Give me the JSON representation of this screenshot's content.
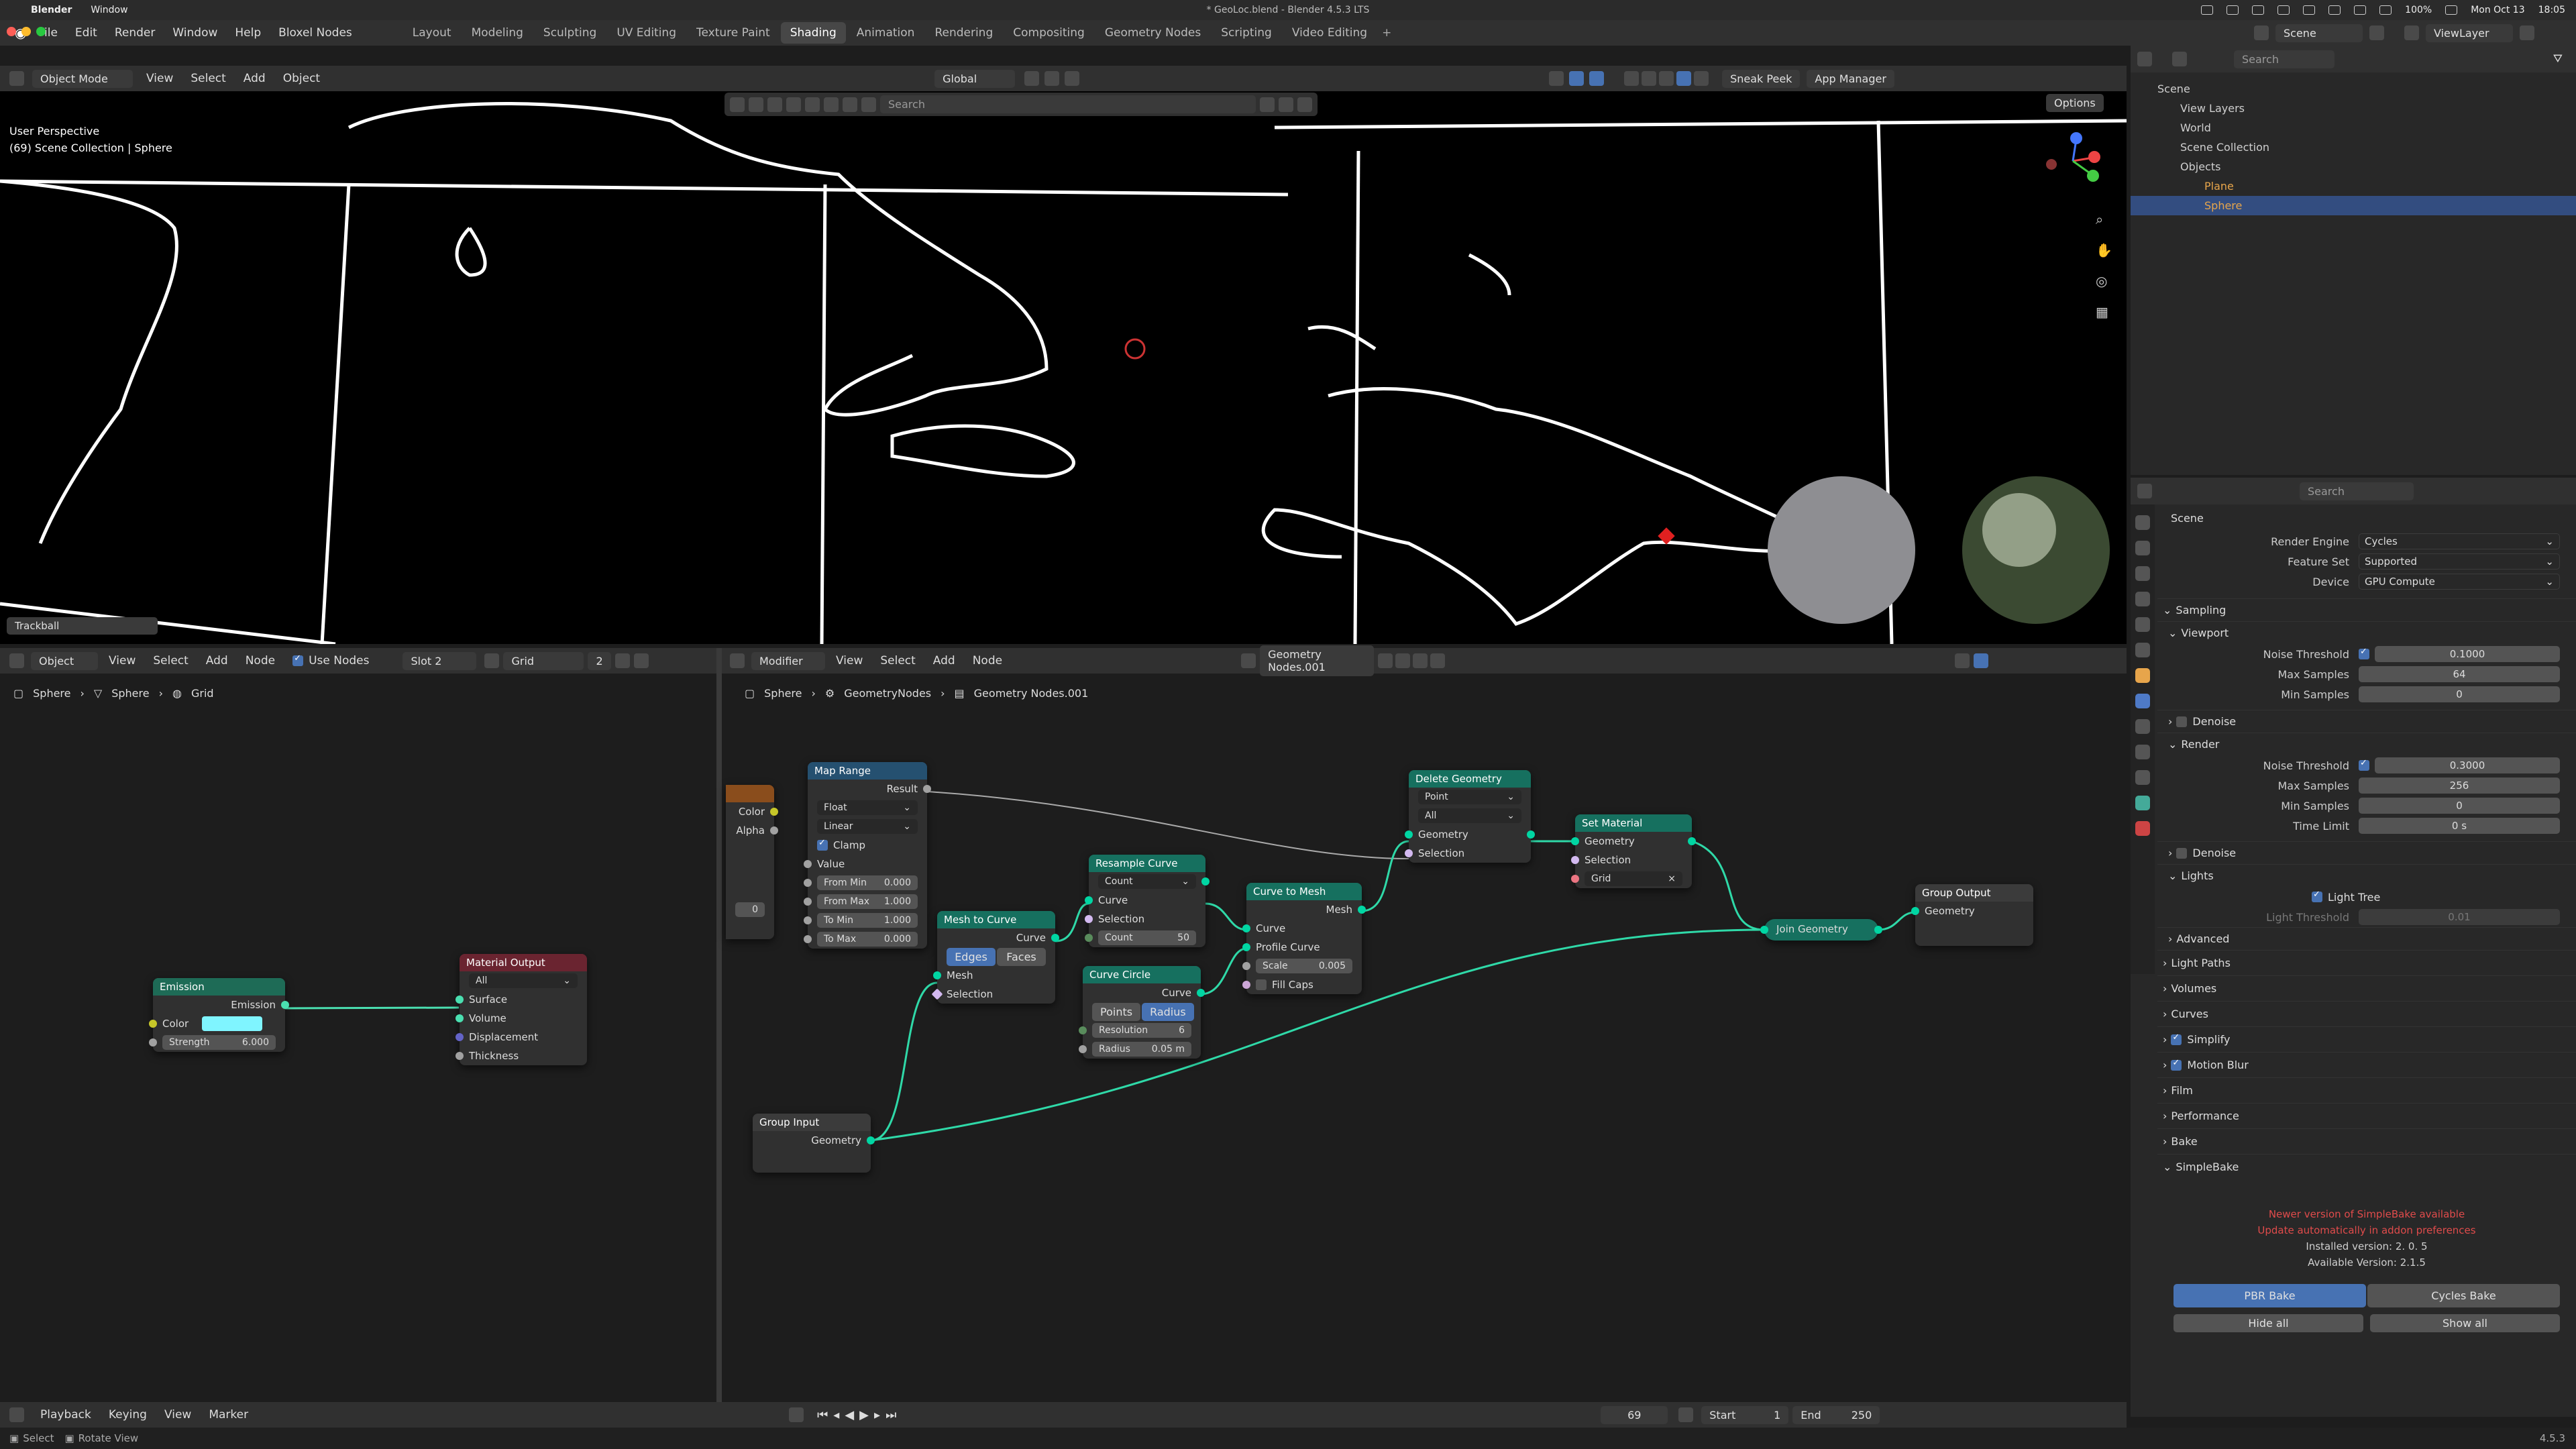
{
  "macbar": {
    "app": "Blender",
    "window": "Window",
    "title": "* GeoLoc.blend - Blender 4.5.3 LTS",
    "date": "Mon Oct 13",
    "time": "18:05",
    "battery": "100%"
  },
  "menu": [
    "File",
    "Edit",
    "Render",
    "Window",
    "Help",
    "Bloxel Nodes"
  ],
  "workspaces": [
    "Layout",
    "Modeling",
    "Sculpting",
    "UV Editing",
    "Texture Paint",
    "Shading",
    "Animation",
    "Rendering",
    "Compositing",
    "Geometry Nodes",
    "Scripting",
    "Video Editing"
  ],
  "active_workspace": "Shading",
  "scene": {
    "name": "Scene",
    "viewlayer": "ViewLayer"
  },
  "viewport": {
    "mode": "Object Mode",
    "menus": [
      "View",
      "Select",
      "Add",
      "Object"
    ],
    "orientation": "Global",
    "search_placeholder": "Search",
    "perspective": "User Perspective",
    "collection": "(69) Scene Collection | Sphere",
    "trackball": "Trackball",
    "sneak_peek": "Sneak Peek",
    "app_manager": "App Manager",
    "options": "Options"
  },
  "shader_editor": {
    "type": "Object",
    "menus": [
      "View",
      "Select",
      "Add",
      "Node"
    ],
    "use_nodes": "Use Nodes",
    "slot": "Slot 2",
    "material": "Grid",
    "users": "2",
    "breadcrumb": [
      "Sphere",
      "Sphere",
      "Grid"
    ],
    "emission": {
      "title": "Emission",
      "out": "Emission",
      "color": "Color",
      "strength_label": "Strength",
      "strength": "6.000",
      "color_hex": "#7ff5ff"
    },
    "material_output": {
      "title": "Material Output",
      "target": "All",
      "inputs": [
        "Surface",
        "Volume",
        "Displacement",
        "Thickness"
      ]
    }
  },
  "geo_editor": {
    "type": "Modifier",
    "menus": [
      "View",
      "Select",
      "Add",
      "Node"
    ],
    "tree": "Geometry Nodes.001",
    "breadcrumb": [
      "Sphere",
      "GeometryNodes",
      "Geometry Nodes.001"
    ],
    "partial": {
      "color": "Color",
      "alpha": "Alpha",
      "value": "0"
    },
    "map_range": {
      "title": "Map Range",
      "result": "Result",
      "type": "Float",
      "interp": "Linear",
      "clamp": "Clamp",
      "value": "Value",
      "rows": [
        [
          "From Min",
          "0.000"
        ],
        [
          "From Max",
          "1.000"
        ],
        [
          "To Min",
          "1.000"
        ],
        [
          "To Max",
          "0.000"
        ]
      ]
    },
    "mesh_to_curve": {
      "title": "Mesh to Curve",
      "curve": "Curve",
      "mode_a": "Edges",
      "mode_b": "Faces",
      "mesh": "Mesh",
      "selection": "Selection"
    },
    "resample": {
      "title": "Resample Curve",
      "mode": "Count",
      "curve": "Curve",
      "selection": "Selection",
      "count_label": "Count",
      "count": "50"
    },
    "circle": {
      "title": "Curve Circle",
      "curve": "Curve",
      "mode_a": "Points",
      "mode_b": "Radius",
      "res_label": "Resolution",
      "res": "6",
      "rad_label": "Radius",
      "rad": "0.05 m"
    },
    "curve_to_mesh": {
      "title": "Curve to Mesh",
      "mesh": "Mesh",
      "curve": "Curve",
      "profile": "Profile Curve",
      "scale_label": "Scale",
      "scale": "0.005",
      "fill": "Fill Caps"
    },
    "delete": {
      "title": "Delete Geometry",
      "domain": "Point",
      "mode": "All",
      "geometry": "Geometry",
      "selection": "Selection"
    },
    "set_material": {
      "title": "Set Material",
      "geometry": "Geometry",
      "selection": "Selection",
      "material": "Grid"
    },
    "join": {
      "title": "Join Geometry"
    },
    "group_output": {
      "title": "Group Output",
      "geometry": "Geometry"
    },
    "group_input": {
      "title": "Group Input",
      "geometry": "Geometry"
    }
  },
  "outliner": {
    "search": "Search",
    "scene": "Scene",
    "items": [
      "View Layers",
      "World",
      "Scene Collection",
      "Objects",
      "Plane",
      "Sphere"
    ]
  },
  "properties": {
    "search": "Search",
    "scene": "Scene",
    "render_engine_label": "Render Engine",
    "render_engine": "Cycles",
    "feature_label": "Feature Set",
    "feature": "Supported",
    "device_label": "Device",
    "device": "GPU Compute",
    "sampling": "Sampling",
    "viewport": "Viewport",
    "noise": "Noise Threshold",
    "vp_noise": "0.1000",
    "max_samples": "Max Samples",
    "vp_max": "64",
    "min_samples": "Min Samples",
    "vp_min": "0",
    "denoise": "Denoise",
    "render": "Render",
    "r_noise": "0.3000",
    "r_max": "256",
    "r_min": "0",
    "time_limit": "Time Limit",
    "r_time": "0 s",
    "lights": "Lights",
    "light_tree": "Light Tree",
    "light_threshold": "Light Threshold",
    "lt_val": "0.01",
    "advanced": "Advanced",
    "sections": [
      "Light Paths",
      "Volumes",
      "Curves",
      "Simplify",
      "Motion Blur",
      "Film",
      "Performance",
      "Bake",
      "SimpleBake"
    ],
    "sb_msg1": "Newer version of SimpleBake available",
    "sb_msg2": "Update automatically in addon preferences",
    "sb_installed": "Installed version: 2. 0. 5",
    "sb_available": "Available Version: 2.1.5",
    "pbr": "PBR Bake",
    "cycles_bake": "Cycles Bake",
    "hide_all": "Hide all",
    "show_all": "Show all"
  },
  "timeline": {
    "menus": [
      "Playback",
      "Keying",
      "View",
      "Marker"
    ],
    "frame": "69",
    "start_label": "Start",
    "start": "1",
    "end_label": "End",
    "end": "250"
  },
  "status": {
    "select": "Select",
    "rotate": "Rotate View",
    "version": "4.5.3"
  }
}
